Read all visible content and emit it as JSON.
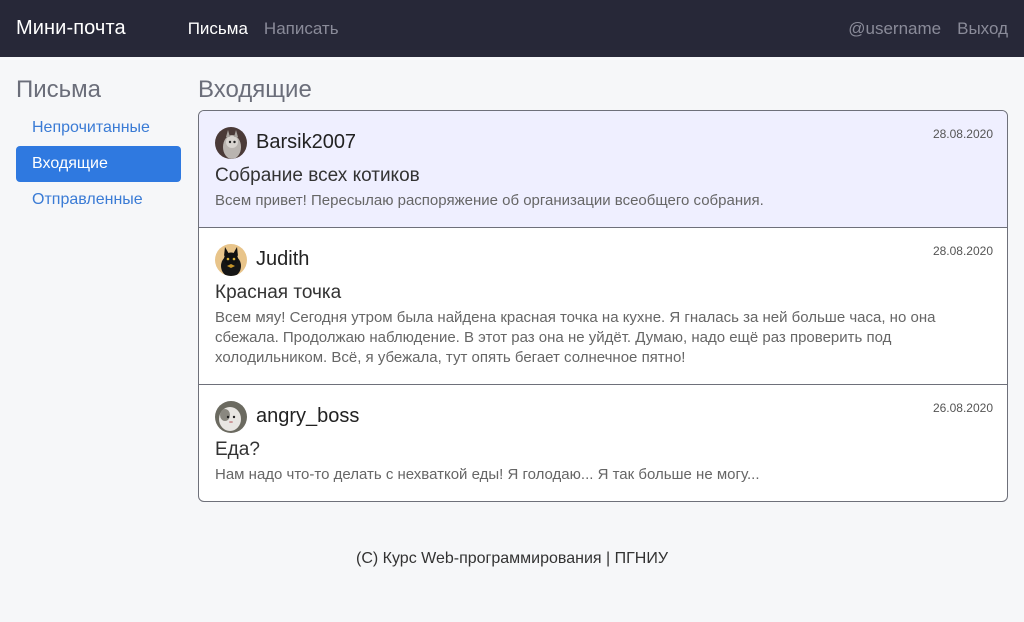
{
  "navbar": {
    "brand": "Мини-почта",
    "links": [
      "Письма",
      "Написать"
    ],
    "username": "@username",
    "logout": "Выход"
  },
  "sidebar": {
    "title": "Письма",
    "items": [
      "Непрочитанные",
      "Входящие",
      "Отправленные"
    ],
    "active": "Входящие"
  },
  "main": {
    "title": "Входящие",
    "mails": [
      {
        "sender": "Barsik2007",
        "date": "28.08.2020",
        "subject": "Собрание всех котиков",
        "body": "Всем привет! Пересылаю распоряжение об организации всеобщего собрания.",
        "avatar": "cat-grey-avatar",
        "highlighted": true
      },
      {
        "sender": "Judith",
        "date": "28.08.2020",
        "subject": "Красная точка",
        "body": "Всем мяу! Сегодня утром была найдена красная точка на кухне. Я гналась за ней больше часа, но она сбежала. Продолжаю наблюдение. В этот раз она не уйдёт. Думаю, надо ещё раз проверить под холодильником. Всё, я убежала, тут опять бегает солнечное пятно!",
        "avatar": "cat-black-avatar",
        "highlighted": false
      },
      {
        "sender": "angry_boss",
        "date": "26.08.2020",
        "subject": "Еда?",
        "body": "Нам надо что-то делать с нехваткой еды! Я голодаю... Я так больше не могу...",
        "avatar": "cat-white-avatar",
        "highlighted": false
      }
    ]
  },
  "footer": {
    "text": "(C) Курс Web-программирования | ПГНИУ"
  },
  "colors": {
    "navbar_bg": "#272838",
    "accent": "#2f79e0",
    "link": "#3a7bd5",
    "highlight_bg": "#efefff"
  }
}
